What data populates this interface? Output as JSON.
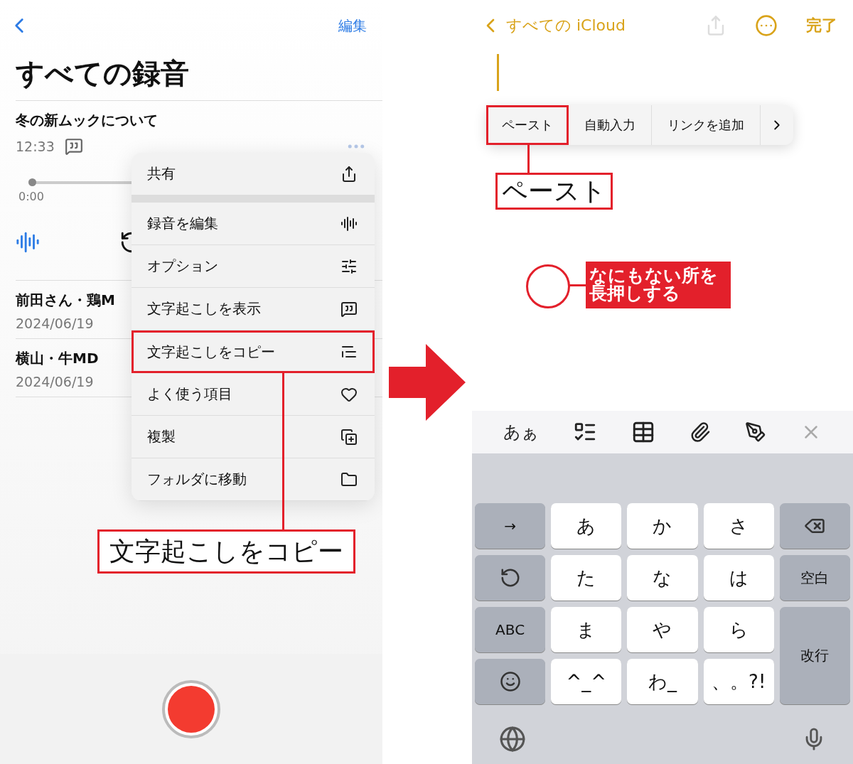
{
  "left_screen": {
    "edit_button": "編集",
    "title": "すべての録音",
    "recordings": [
      {
        "title": "冬の新ムックについて",
        "time": "12:33",
        "player": {
          "elapsed": "0:00",
          "level": 0
        }
      },
      {
        "title": "前田さん・鶏M",
        "date": "2024/06/19"
      },
      {
        "title": "横山・牛MD",
        "date": "2024/06/19"
      }
    ],
    "context_menu": [
      [
        {
          "label": "共有",
          "highlighted": false
        }
      ],
      [
        {
          "label": "録音を編集",
          "highlighted": false
        },
        {
          "label": "オプション",
          "highlighted": false
        },
        {
          "label": "文字起こしを表示",
          "highlighted": false
        },
        {
          "label": "文字起こしをコピー",
          "highlighted": true
        },
        {
          "label": "よく使う項目",
          "highlighted": false
        },
        {
          "label": "複製",
          "highlighted": false
        },
        {
          "label": "フォルダに移動",
          "highlighted": false
        }
      ]
    ],
    "annotation": "文字起こしをコピー"
  },
  "right_screen": {
    "back_label": "すべての iCloud",
    "done_button": "完了",
    "edit_menu": [
      {
        "label": "ペースト",
        "highlighted": true
      },
      {
        "label": "自動入力",
        "highlighted": false
      },
      {
        "label": "リンクを追加",
        "highlighted": false
      }
    ],
    "annotation": "ペースト",
    "callout": "なにもない所を長押しする",
    "toolbar_text": "あぁ",
    "keys": [
      {
        "kind": "function",
        "label": "→"
      },
      {
        "kind": "letter",
        "label": "あ"
      },
      {
        "kind": "letter",
        "label": "か"
      },
      {
        "kind": "letter",
        "label": "さ"
      },
      {
        "kind": "backspace"
      },
      {
        "kind": "undo"
      },
      {
        "kind": "letter",
        "label": "た"
      },
      {
        "kind": "letter",
        "label": "な"
      },
      {
        "kind": "letter",
        "label": "は"
      },
      {
        "kind": "function",
        "label": "空白"
      },
      {
        "kind": "function",
        "label": "ABC"
      },
      {
        "kind": "letter",
        "label": "ま"
      },
      {
        "kind": "letter",
        "label": "や"
      },
      {
        "kind": "letter",
        "label": "ら"
      },
      {
        "kind": "tall",
        "label": "改行"
      },
      {
        "kind": "emoji"
      },
      {
        "kind": "letter",
        "label": "^_^"
      },
      {
        "kind": "letter",
        "label": "わ_"
      },
      {
        "kind": "letter",
        "label": "、。?!"
      }
    ]
  }
}
